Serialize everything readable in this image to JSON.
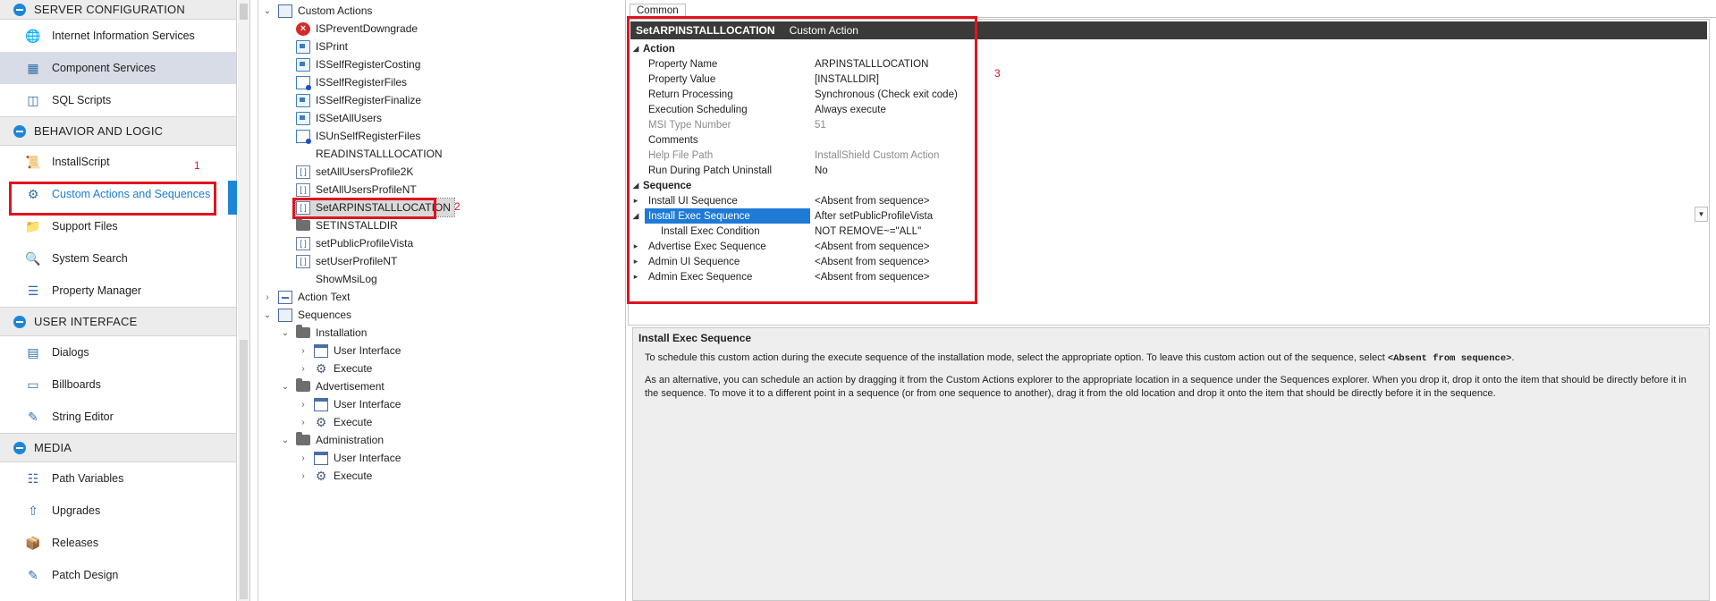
{
  "nav": {
    "sections": [
      {
        "label": "SERVER CONFIGURATION",
        "items": [
          {
            "label": "Internet Information Services",
            "icon": "globe-icon"
          },
          {
            "label": "Component Services",
            "icon": "components-icon"
          },
          {
            "label": "SQL Scripts",
            "icon": "database-icon"
          }
        ]
      },
      {
        "label": "BEHAVIOR AND LOGIC",
        "items": [
          {
            "label": "InstallScript",
            "icon": "script-icon"
          },
          {
            "label": "Custom Actions and Sequences",
            "icon": "custom-actions-icon"
          },
          {
            "label": "Support Files",
            "icon": "folder-icon"
          },
          {
            "label": "System Search",
            "icon": "search-icon"
          },
          {
            "label": "Property Manager",
            "icon": "property-icon"
          }
        ]
      },
      {
        "label": "USER INTERFACE",
        "items": [
          {
            "label": "Dialogs",
            "icon": "dialog-icon"
          },
          {
            "label": "Billboards",
            "icon": "billboard-icon"
          },
          {
            "label": "String Editor",
            "icon": "string-editor-icon"
          }
        ]
      },
      {
        "label": "MEDIA",
        "items": [
          {
            "label": "Path Variables",
            "icon": "path-variables-icon"
          },
          {
            "label": "Upgrades",
            "icon": "upgrades-icon"
          },
          {
            "label": "Releases",
            "icon": "releases-icon"
          },
          {
            "label": "Patch Design",
            "icon": "patch-design-icon"
          }
        ]
      }
    ]
  },
  "tree": {
    "custom_actions": "Custom Actions",
    "actions": [
      "ISPreventDowngrade",
      "ISPrint",
      "ISSelfRegisterCosting",
      "ISSelfRegisterFiles",
      "ISSelfRegisterFinalize",
      "ISSetAllUsers",
      "ISUnSelfRegisterFiles",
      "READINSTALLLOCATION",
      "setAllUsersProfile2K",
      "SetAllUsersProfileNT",
      "SetARPINSTALLLOCATION",
      "SETINSTALLDIR",
      "setPublicProfileVista",
      "setUserProfileNT",
      "ShowMsiLog"
    ],
    "action_text": "Action Text",
    "sequences": "Sequences",
    "installation": "Installation",
    "advertisement": "Advertisement",
    "administration": "Administration",
    "user_interface": "User Interface",
    "execute": "Execute"
  },
  "tab": {
    "label": "Common"
  },
  "grid": {
    "header_name": "SetARPINSTALLLOCATION",
    "header_type": "Custom Action",
    "action_category": "Action",
    "sequence_category": "Sequence",
    "action_props": [
      {
        "name": "Property Name",
        "value": "ARPINSTALLLOCATION"
      },
      {
        "name": "Property Value",
        "value": "[INSTALLDIR]"
      },
      {
        "name": "Return Processing",
        "value": "Synchronous (Check exit code)"
      },
      {
        "name": "Execution Scheduling",
        "value": "Always execute"
      },
      {
        "name": "MSI Type Number",
        "value": "51"
      },
      {
        "name": "Comments",
        "value": ""
      },
      {
        "name": "Help File Path",
        "value": "InstallShield Custom Action"
      },
      {
        "name": "Run During Patch Uninstall",
        "value": "No"
      }
    ],
    "sequence_props": [
      {
        "name": "Install UI Sequence",
        "value": "<Absent from sequence>"
      },
      {
        "name": "Install Exec Sequence",
        "value": "After setPublicProfileVista"
      },
      {
        "name": "Install Exec Condition",
        "value": "NOT REMOVE~=\"ALL\""
      },
      {
        "name": "Advertise Exec Sequence",
        "value": "<Absent from sequence>"
      },
      {
        "name": "Admin UI Sequence",
        "value": "<Absent from sequence>"
      },
      {
        "name": "Admin Exec Sequence",
        "value": "<Absent from sequence>"
      }
    ]
  },
  "description": {
    "title": "Install Exec Sequence",
    "para1": "To schedule this custom action during the execute sequence of the installation mode, select the appropriate option. To leave this custom action out of the sequence, select",
    "para1_code": "<Absent from sequence>",
    "para1_end": ".",
    "para2": "As an alternative, you can schedule an action by dragging it from the Custom Actions explorer to the appropriate location in a sequence under the Sequences explorer. When you drop it, drop it onto the item that should be directly before it in the sequence. To move it to a different point in a sequence (or from one sequence to another), drag it from the old location and drop it onto the item that should be directly before it in the sequence."
  },
  "annotations": {
    "one": "1",
    "two": "2",
    "three": "3"
  },
  "colors": {
    "accent": "#1f86d6",
    "annotation_red": "#e0141e",
    "header_bg": "#3a3a3a",
    "selection": "#1f7ad6"
  }
}
